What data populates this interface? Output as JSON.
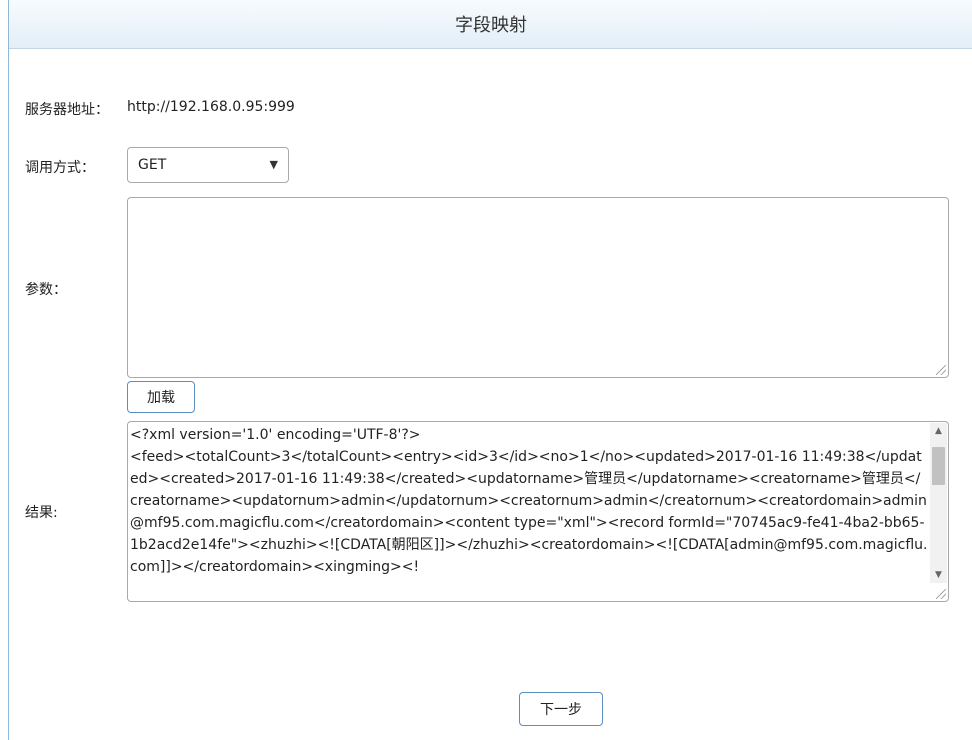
{
  "title": "字段映射",
  "server": {
    "label": "服务器地址：",
    "value": "http://192.168.0.95:999"
  },
  "method": {
    "label": "调用方式：",
    "selected": "GET",
    "arrow_icon": "triangle-down"
  },
  "params": {
    "label": "参数：",
    "value": ""
  },
  "load_button": "加载",
  "result": {
    "label": "结果:",
    "text": "<?xml version='1.0' encoding='UTF-8'?>\n<feed><totalCount>3</totalCount><entry><id>3</id><no>1</no><updated>2017-01-16 11:49:38</updated><created>2017-01-16 11:49:38</created><updatorname>管理员</updatorname><creatorname>管理员</creatorname><updatornum>admin</updatornum><creatornum>admin</creatornum><creatordomain>admin@mf95.com.magicflu.com</creatordomain><content type=\"xml\"><record formId=\"70745ac9-fe41-4ba2-bb65-1b2acd2e14fe\"><zhuzhi><![CDATA[朝阳区]]></zhuzhi><creatordomain><![CDATA[admin@mf95.com.magicflu.com]]></creatordomain><xingming><!"
  },
  "next_button": "下一步"
}
